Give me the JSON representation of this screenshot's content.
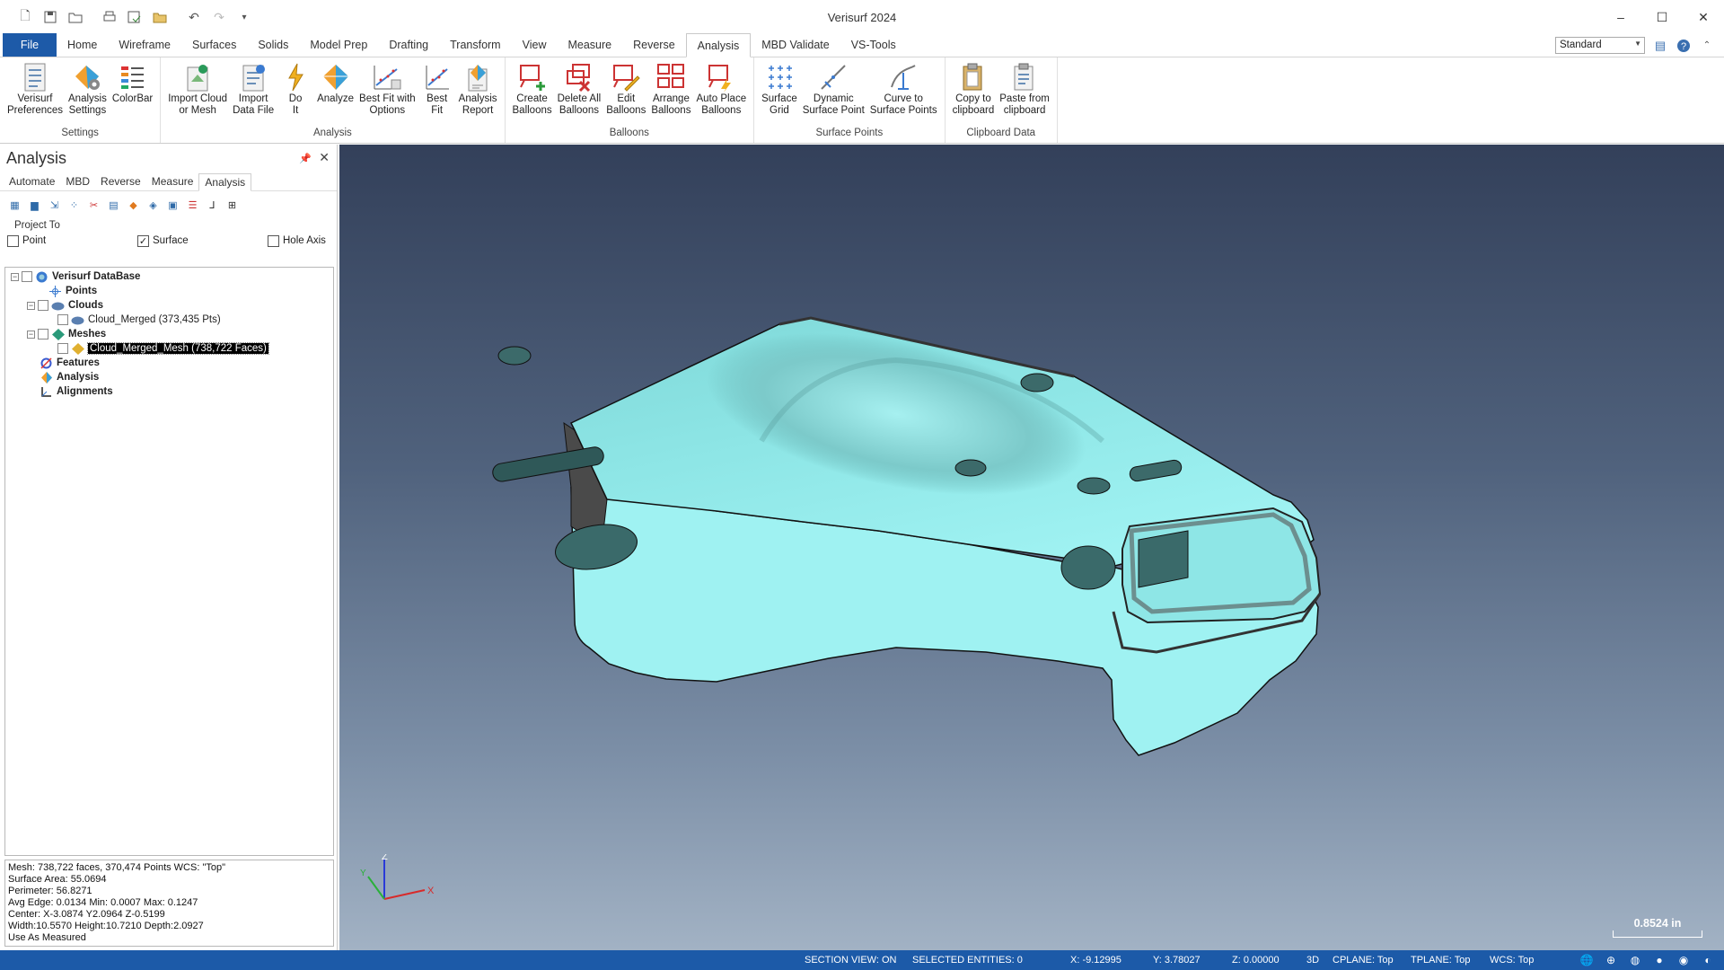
{
  "app": {
    "title": "Verisurf 2024"
  },
  "ribbon_tabs": [
    "File",
    "Home",
    "Wireframe",
    "Surfaces",
    "Solids",
    "Model Prep",
    "Drafting",
    "Transform",
    "View",
    "Measure",
    "Reverse",
    "Analysis",
    "MBD Validate",
    "VS-Tools"
  ],
  "active_tab": "Analysis",
  "view_combo": {
    "value": "Standard"
  },
  "groups": {
    "settings": {
      "label": "Settings",
      "buttons": [
        "Verisurf\nPreferences",
        "Analysis\nSettings",
        "ColorBar"
      ]
    },
    "analysis": {
      "label": "Analysis",
      "buttons": [
        "Import Cloud\nor Mesh",
        "Import\nData File",
        "Do\nIt",
        "Analyze",
        "Best Fit with\nOptions",
        "Best\nFit",
        "Analysis\nReport"
      ]
    },
    "balloons": {
      "label": "Balloons",
      "buttons": [
        "Create\nBalloons",
        "Delete All\nBalloons",
        "Edit\nBalloons",
        "Arrange\nBalloons",
        "Auto Place\nBalloons"
      ]
    },
    "surface_points": {
      "label": "Surface Points",
      "buttons": [
        "Surface\nGrid",
        "Dynamic\nSurface Point",
        "Curve to\nSurface Points"
      ]
    },
    "clipboard": {
      "label": "Clipboard Data",
      "buttons": [
        "Copy to\nclipboard",
        "Paste from\nclipboard"
      ]
    }
  },
  "panel": {
    "title": "Analysis",
    "tabs": [
      "Automate",
      "MBD",
      "Reverse",
      "Measure",
      "Analysis"
    ],
    "active_tab": "Analysis",
    "project_to": {
      "title": "Project To",
      "point": "Point",
      "point_checked": false,
      "surface": "Surface",
      "surface_checked": true,
      "hole_axis": "Hole Axis",
      "hole_axis_checked": false
    },
    "tree": {
      "root": "Verisurf DataBase",
      "points": "Points",
      "clouds": "Clouds",
      "cloud_item": "Cloud_Merged (373,435 Pts)",
      "meshes": "Meshes",
      "mesh_item": "Cloud_Merged_Mesh (738,722 Faces)",
      "features": "Features",
      "analysis": "Analysis",
      "alignments": "Alignments"
    },
    "info_lines": [
      "Mesh: 738,722 faces, 370,474 Points  WCS: \"Top\"",
      "Surface Area: 55.0694",
      "Perimeter: 56.8271",
      "Avg Edge: 0.0134 Min: 0.0007 Max: 0.1247",
      "Center: X-3.0874 Y2.0964 Z-0.5199",
      "Width:10.5570 Height:10.7210 Depth:2.0927",
      "Use As Measured"
    ]
  },
  "viewport": {
    "scale_label": "0.8524 in",
    "axes": {
      "x": "X",
      "y": "Y",
      "z": "Z"
    },
    "mesh_color": "#8ee6e6"
  },
  "status": {
    "section_view": "SECTION VIEW: ON",
    "selected": "SELECTED ENTITIES: 0",
    "x": "X:   -9.12995",
    "y": "Y:   3.78027",
    "z": "Z:   0.00000",
    "mode": "3D",
    "cplane": "CPLANE: Top",
    "tplane": "TPLANE: Top",
    "wcs": "WCS: Top"
  },
  "colors": {
    "file_tab": "#1d5aa8",
    "statusbar": "#1c5aa8",
    "accent_orange": "#e07a1f"
  }
}
